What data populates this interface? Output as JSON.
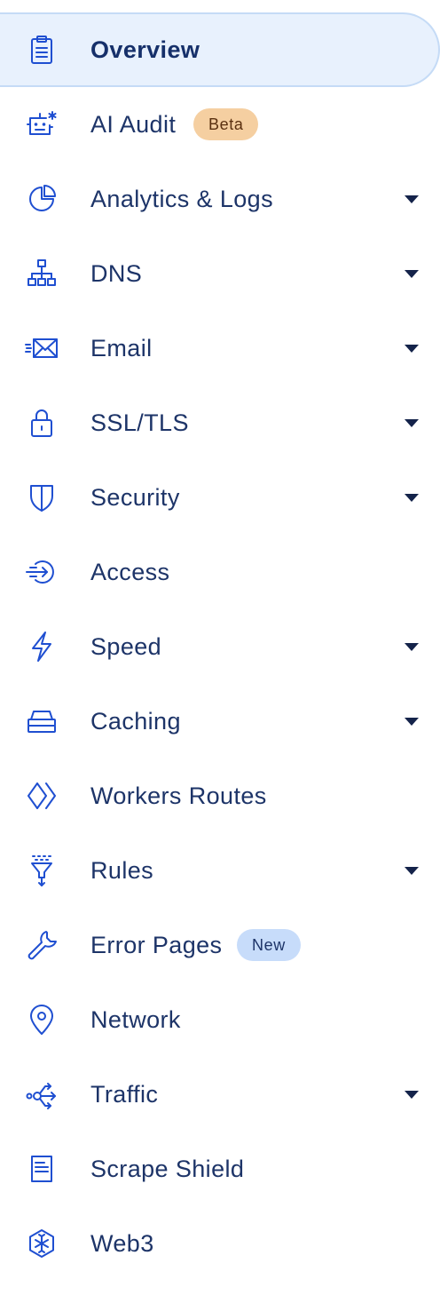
{
  "sidebar": {
    "items": [
      {
        "label": "Overview",
        "icon": "clipboard-icon",
        "active": true,
        "expandable": false
      },
      {
        "label": "AI Audit",
        "icon": "robot-icon",
        "badge": "Beta",
        "expandable": false
      },
      {
        "label": "Analytics & Logs",
        "icon": "pie-chart-icon",
        "expandable": true
      },
      {
        "label": "DNS",
        "icon": "network-tree-icon",
        "expandable": true
      },
      {
        "label": "Email",
        "icon": "envelope-icon",
        "expandable": true
      },
      {
        "label": "SSL/TLS",
        "icon": "lock-icon",
        "expandable": true
      },
      {
        "label": "Security",
        "icon": "shield-icon",
        "expandable": true
      },
      {
        "label": "Access",
        "icon": "sign-in-icon",
        "expandable": false
      },
      {
        "label": "Speed",
        "icon": "lightning-icon",
        "expandable": true
      },
      {
        "label": "Caching",
        "icon": "server-stack-icon",
        "expandable": true
      },
      {
        "label": "Workers Routes",
        "icon": "workers-icon",
        "expandable": false
      },
      {
        "label": "Rules",
        "icon": "filter-funnel-icon",
        "expandable": true
      },
      {
        "label": "Error Pages",
        "icon": "wrench-icon",
        "badge": "New",
        "expandable": false
      },
      {
        "label": "Network",
        "icon": "location-pin-icon",
        "expandable": false
      },
      {
        "label": "Traffic",
        "icon": "traffic-flow-icon",
        "expandable": true
      },
      {
        "label": "Scrape Shield",
        "icon": "document-icon",
        "expandable": false
      },
      {
        "label": "Web3",
        "icon": "web3-cube-icon",
        "expandable": false
      }
    ]
  },
  "colors": {
    "icon": "#1f4fd1",
    "text": "#1d3468",
    "active_bg": "#e8f1fd",
    "active_border": "#c5dbf6",
    "beta_badge_bg": "#f5cfa1",
    "new_badge_bg": "#c7dcfa"
  }
}
